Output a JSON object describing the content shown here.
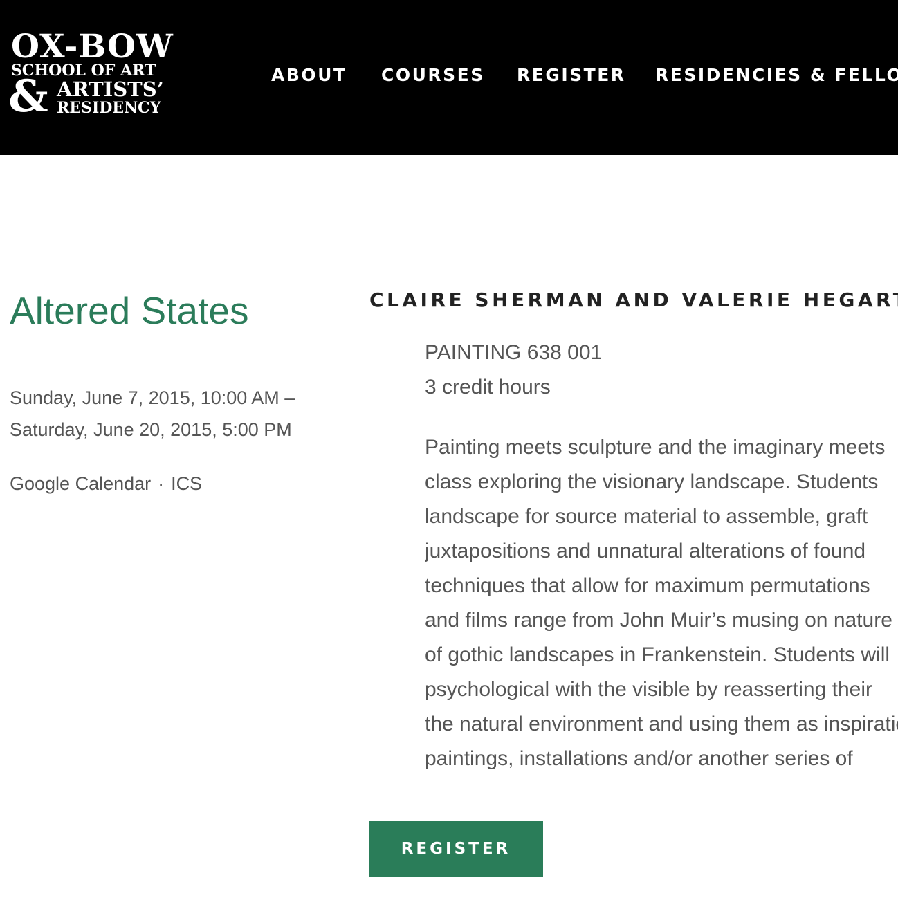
{
  "header": {
    "logo": {
      "line1": "OX-BOW",
      "line2": "SCHOOL OF ART",
      "ampersand": "&",
      "line3": "ARTISTS’",
      "line4": "RESIDENCY"
    },
    "nav": [
      {
        "label": "ABOUT"
      },
      {
        "label": "COURSES"
      },
      {
        "label": "REGISTER"
      },
      {
        "label": "RESIDENCIES & FELLOWSHIPS"
      }
    ]
  },
  "event": {
    "title": "Altered States",
    "date_start": "Sunday, June 7, 2015, 10:00 AM –",
    "date_end": "Saturday, June 20, 2015, 5:00 PM",
    "calendar_links": {
      "google": "Google Calendar",
      "separator": "·",
      "ics": "ICS"
    }
  },
  "course": {
    "instructors": "CLAIRE SHERMAN AND VALERIE HEGARTY",
    "code": "PAINTING 638 001",
    "credits": "3 credit hours",
    "description_lines": [
      "Painting meets sculpture and the imaginary meets",
      "class exploring the visionary landscape. Students",
      "landscape for source material to assemble, graft",
      "juxtapositions and unnatural alterations of found",
      "techniques that allow for maximum permutations",
      "and films range from John Muir’s musing on nature",
      "of gothic landscapes in Frankenstein. Students will",
      "psychological with the visible by reasserting their",
      "the natural environment and using them as inspiration",
      "paintings, installations and/or another series of"
    ],
    "register_label": "REGISTER"
  },
  "colors": {
    "header_bg": "#000000",
    "accent_green": "#2b7c5a",
    "button_green": "#2a7d59",
    "body_text": "#555555"
  }
}
